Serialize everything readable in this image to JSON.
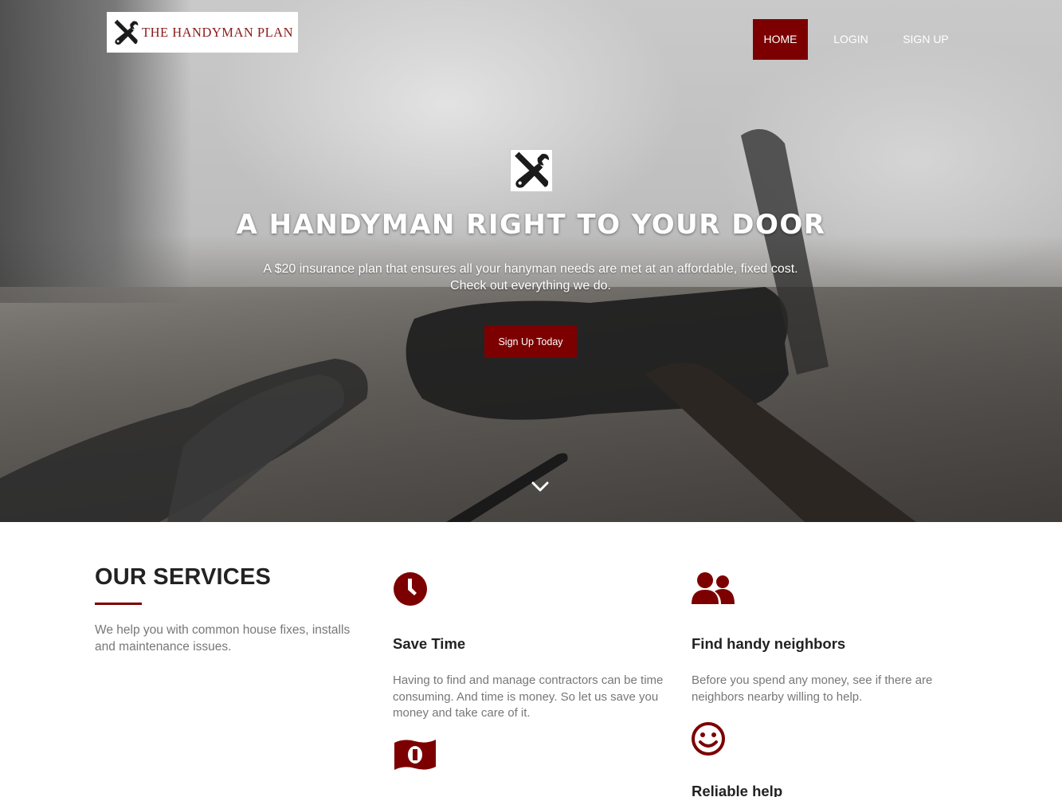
{
  "brand": {
    "name": "THE HANDYMAN PLAN",
    "icon": "wrench-screwdriver-icon"
  },
  "nav": {
    "items": [
      {
        "label": "HOME",
        "active": true
      },
      {
        "label": "LOGIN",
        "active": false
      },
      {
        "label": "SIGN UP",
        "active": false
      }
    ]
  },
  "hero": {
    "icon": "wrench-screwdriver-icon",
    "title": "A HANDYMAN RIGHT TO YOUR DOOR",
    "subtitle_line1": "A $20 insurance plan that ensures all your hanyman needs are met at an affordable, fixed cost.",
    "subtitle_line2": "Check out everything we do.",
    "cta_label": "Sign Up Today",
    "scroll_icon": "chevron-down-icon"
  },
  "services": {
    "title": "OUR SERVICES",
    "description": "We help you with common house fixes, installs and maintenance issues.",
    "items": [
      {
        "icon": "clock-icon",
        "heading": "Save Time",
        "text": "Having to find and manage contractors can be time consuming. And time is money. So let us save you money and take care of it."
      },
      {
        "icon": "users-icon",
        "heading": "Find handy neighbors",
        "text": "Before you spend any money, see if there are neighbors nearby willing to help."
      },
      {
        "icon": "money-icon",
        "heading": "",
        "text": ""
      },
      {
        "icon": "smile-icon",
        "heading": "Reliable help",
        "text": ""
      }
    ]
  },
  "colors": {
    "accent": "#7c0000",
    "brand_text": "#8b1a1a",
    "heading": "#222222",
    "body_text": "#777777"
  }
}
